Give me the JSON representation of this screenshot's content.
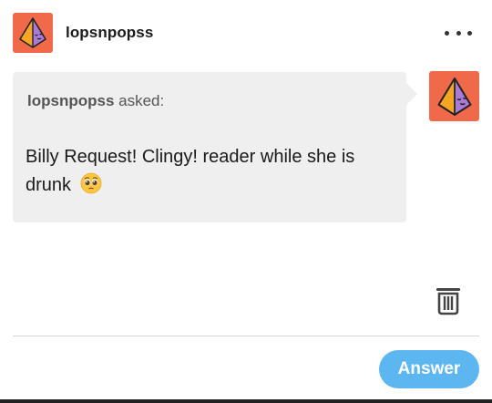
{
  "header": {
    "username": "lopsnpopss",
    "avatar_icon": "pyramid-avatar-icon",
    "more_icon": "more-options-icon"
  },
  "ask": {
    "asker_name": "lopsnpopss",
    "asked_label": "asked:",
    "question": "Billy Request! Clingy! reader while she is drunk",
    "emoji": "pleading-face-emoji",
    "answerer_avatar_icon": "pyramid-avatar-icon"
  },
  "actions": {
    "delete_icon": "trash-icon",
    "answer_label": "Answer"
  },
  "colors": {
    "avatar_bg": "#f06a4a",
    "pyramid_left": "#f5a623",
    "pyramid_right": "#a87bd6",
    "bubble_bg": "#efefef",
    "answer_button": "#5cb6f0"
  }
}
